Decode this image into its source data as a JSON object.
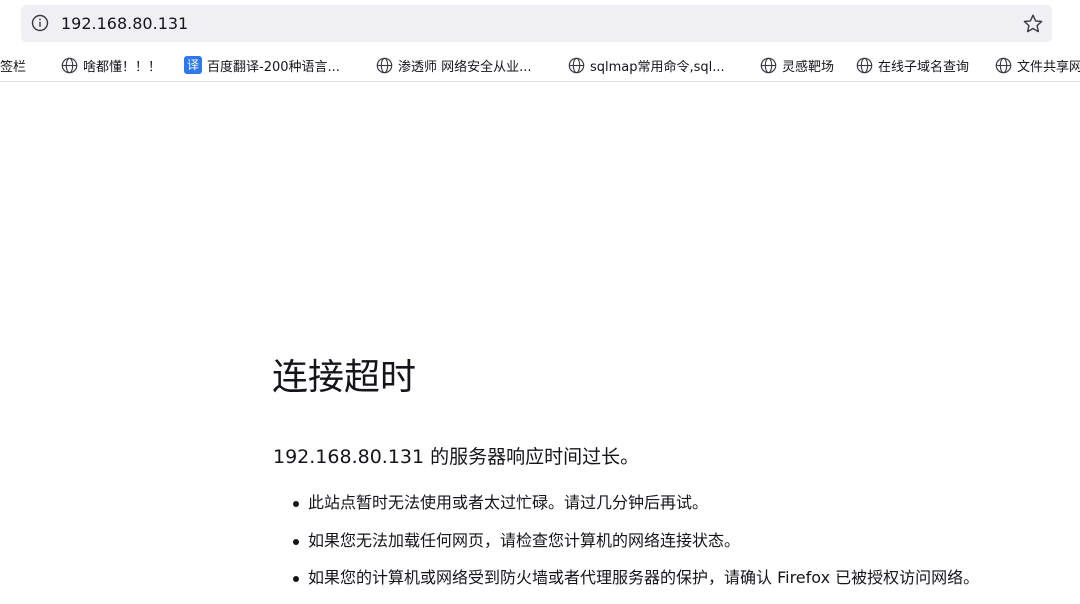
{
  "toolbar": {
    "url": "192.168.80.131",
    "info_icon": "info-icon",
    "bookmark_star_icon": "star-icon"
  },
  "bookmarks": [
    {
      "label": "书签栏",
      "icon": "globe-icon"
    },
    {
      "label": "啥都懂！！！",
      "icon": "globe-icon"
    },
    {
      "label": "百度翻译-200种语言...",
      "icon": "translate-icon",
      "icon_text": "译"
    },
    {
      "label": "渗透师 网络安全从业...",
      "icon": "globe-icon"
    },
    {
      "label": "sqlmap常用命令,sql...",
      "icon": "globe-icon"
    },
    {
      "label": "灵感靶场",
      "icon": "globe-icon"
    },
    {
      "label": "在线子域名查询",
      "icon": "globe-icon"
    },
    {
      "label": "文件共享网",
      "icon": "globe-icon"
    }
  ],
  "error": {
    "title": "连接超时",
    "description": "192.168.80.131 的服务器响应时间过长。",
    "suggestions": [
      "此站点暂时无法使用或者太过忙碌。请过几分钟后再试。",
      "如果您无法加载任何网页，请检查您计算机的网络连接状态。",
      "如果您的计算机或网络受到防火墙或者代理服务器的保护，请确认 Firefox 已被授权访问网络。"
    ]
  },
  "colors": {
    "urlbar_bg": "#f0f0f4",
    "text": "#15141a",
    "translate_icon_bg": "#2e78ee"
  }
}
